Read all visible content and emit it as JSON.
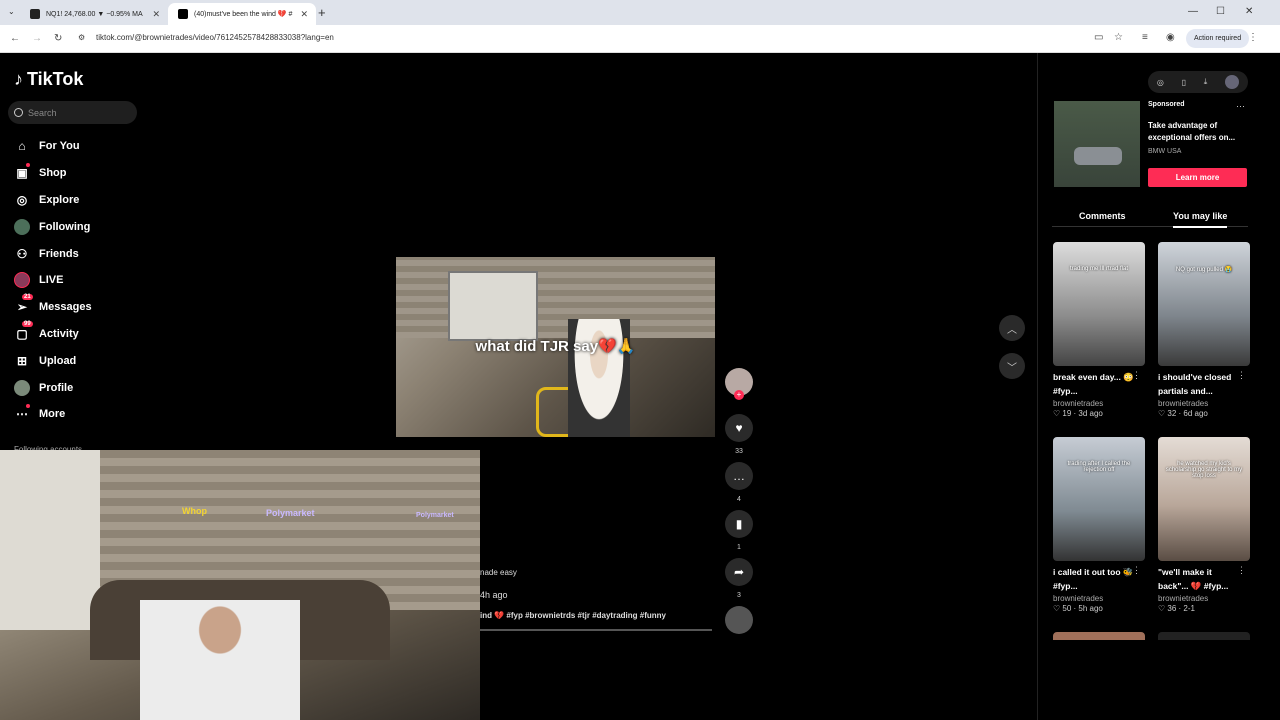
{
  "browser": {
    "tabs": [
      {
        "title": "NQ1! 24,768.00 ▼ −0.95% MA",
        "active": false
      },
      {
        "title": "(40)must've been the wind 💔 #",
        "active": true
      }
    ],
    "url": "tiktok.com/@brownietrades/video/7612452578428833038?lang=en",
    "action_label": "Action required"
  },
  "sidebar": {
    "logo": "TikTok",
    "search_placeholder": "Search",
    "items": [
      {
        "label": "For You",
        "icon": "home-icon"
      },
      {
        "label": "Shop",
        "icon": "shop-icon"
      },
      {
        "label": "Explore",
        "icon": "compass-icon"
      },
      {
        "label": "Following",
        "icon": "following-avatar-icon"
      },
      {
        "label": "Friends",
        "icon": "friends-icon"
      },
      {
        "label": "LIVE",
        "icon": "live-icon"
      },
      {
        "label": "Messages",
        "icon": "messages-icon",
        "badge": "21"
      },
      {
        "label": "Activity",
        "icon": "activity-icon",
        "badge": "99"
      },
      {
        "label": "Upload",
        "icon": "upload-icon"
      },
      {
        "label": "Profile",
        "icon": "profile-avatar-icon"
      },
      {
        "label": "More",
        "icon": "more-icon"
      }
    ],
    "following_accounts": "Following accounts"
  },
  "video": {
    "caption_overlay": "what did TJR say💔🙏",
    "desc_partial": "nade easy",
    "time_partial": "4h ago",
    "hashtags_partial": "ind 💔 #fyp #brownietrds #tjr #daytrading #funny",
    "likes": "33",
    "comments": "4",
    "saves": "1",
    "shares": "3"
  },
  "pip": {
    "neon1": "Whop",
    "neon2": "Polymarket",
    "neon3": "Polymarket"
  },
  "ad": {
    "sponsored": "Sponsored",
    "title": "Take advantage of exceptional offers on...",
    "brand": "BMW USA",
    "cta": "Learn more"
  },
  "panel_tabs": {
    "comments": "Comments",
    "you_may_like": "You may like"
  },
  "recommendations": [
    {
      "title": "break even day... 😳 #fyp...",
      "user": "brownietrades",
      "stats": "19 · 3d ago",
      "overlay": "trading me Ill rtrad flat"
    },
    {
      "title": "i should've closed partials and...",
      "user": "brownietrades",
      "stats": "32 · 6d ago",
      "overlay": "NQ got rug pulled 😭"
    },
    {
      "title": "i called it out too 🐝 #fyp...",
      "user": "brownietrades",
      "stats": "50 · 5h ago",
      "overlay": "trading after I called the rejection off"
    },
    {
      "title": "\"we'll make it back\"... 💔 #fyp...",
      "user": "brownietrades",
      "stats": "36 · 2-1",
      "overlay": "he watched my kid's scholarship go straight to my stop loss"
    }
  ]
}
